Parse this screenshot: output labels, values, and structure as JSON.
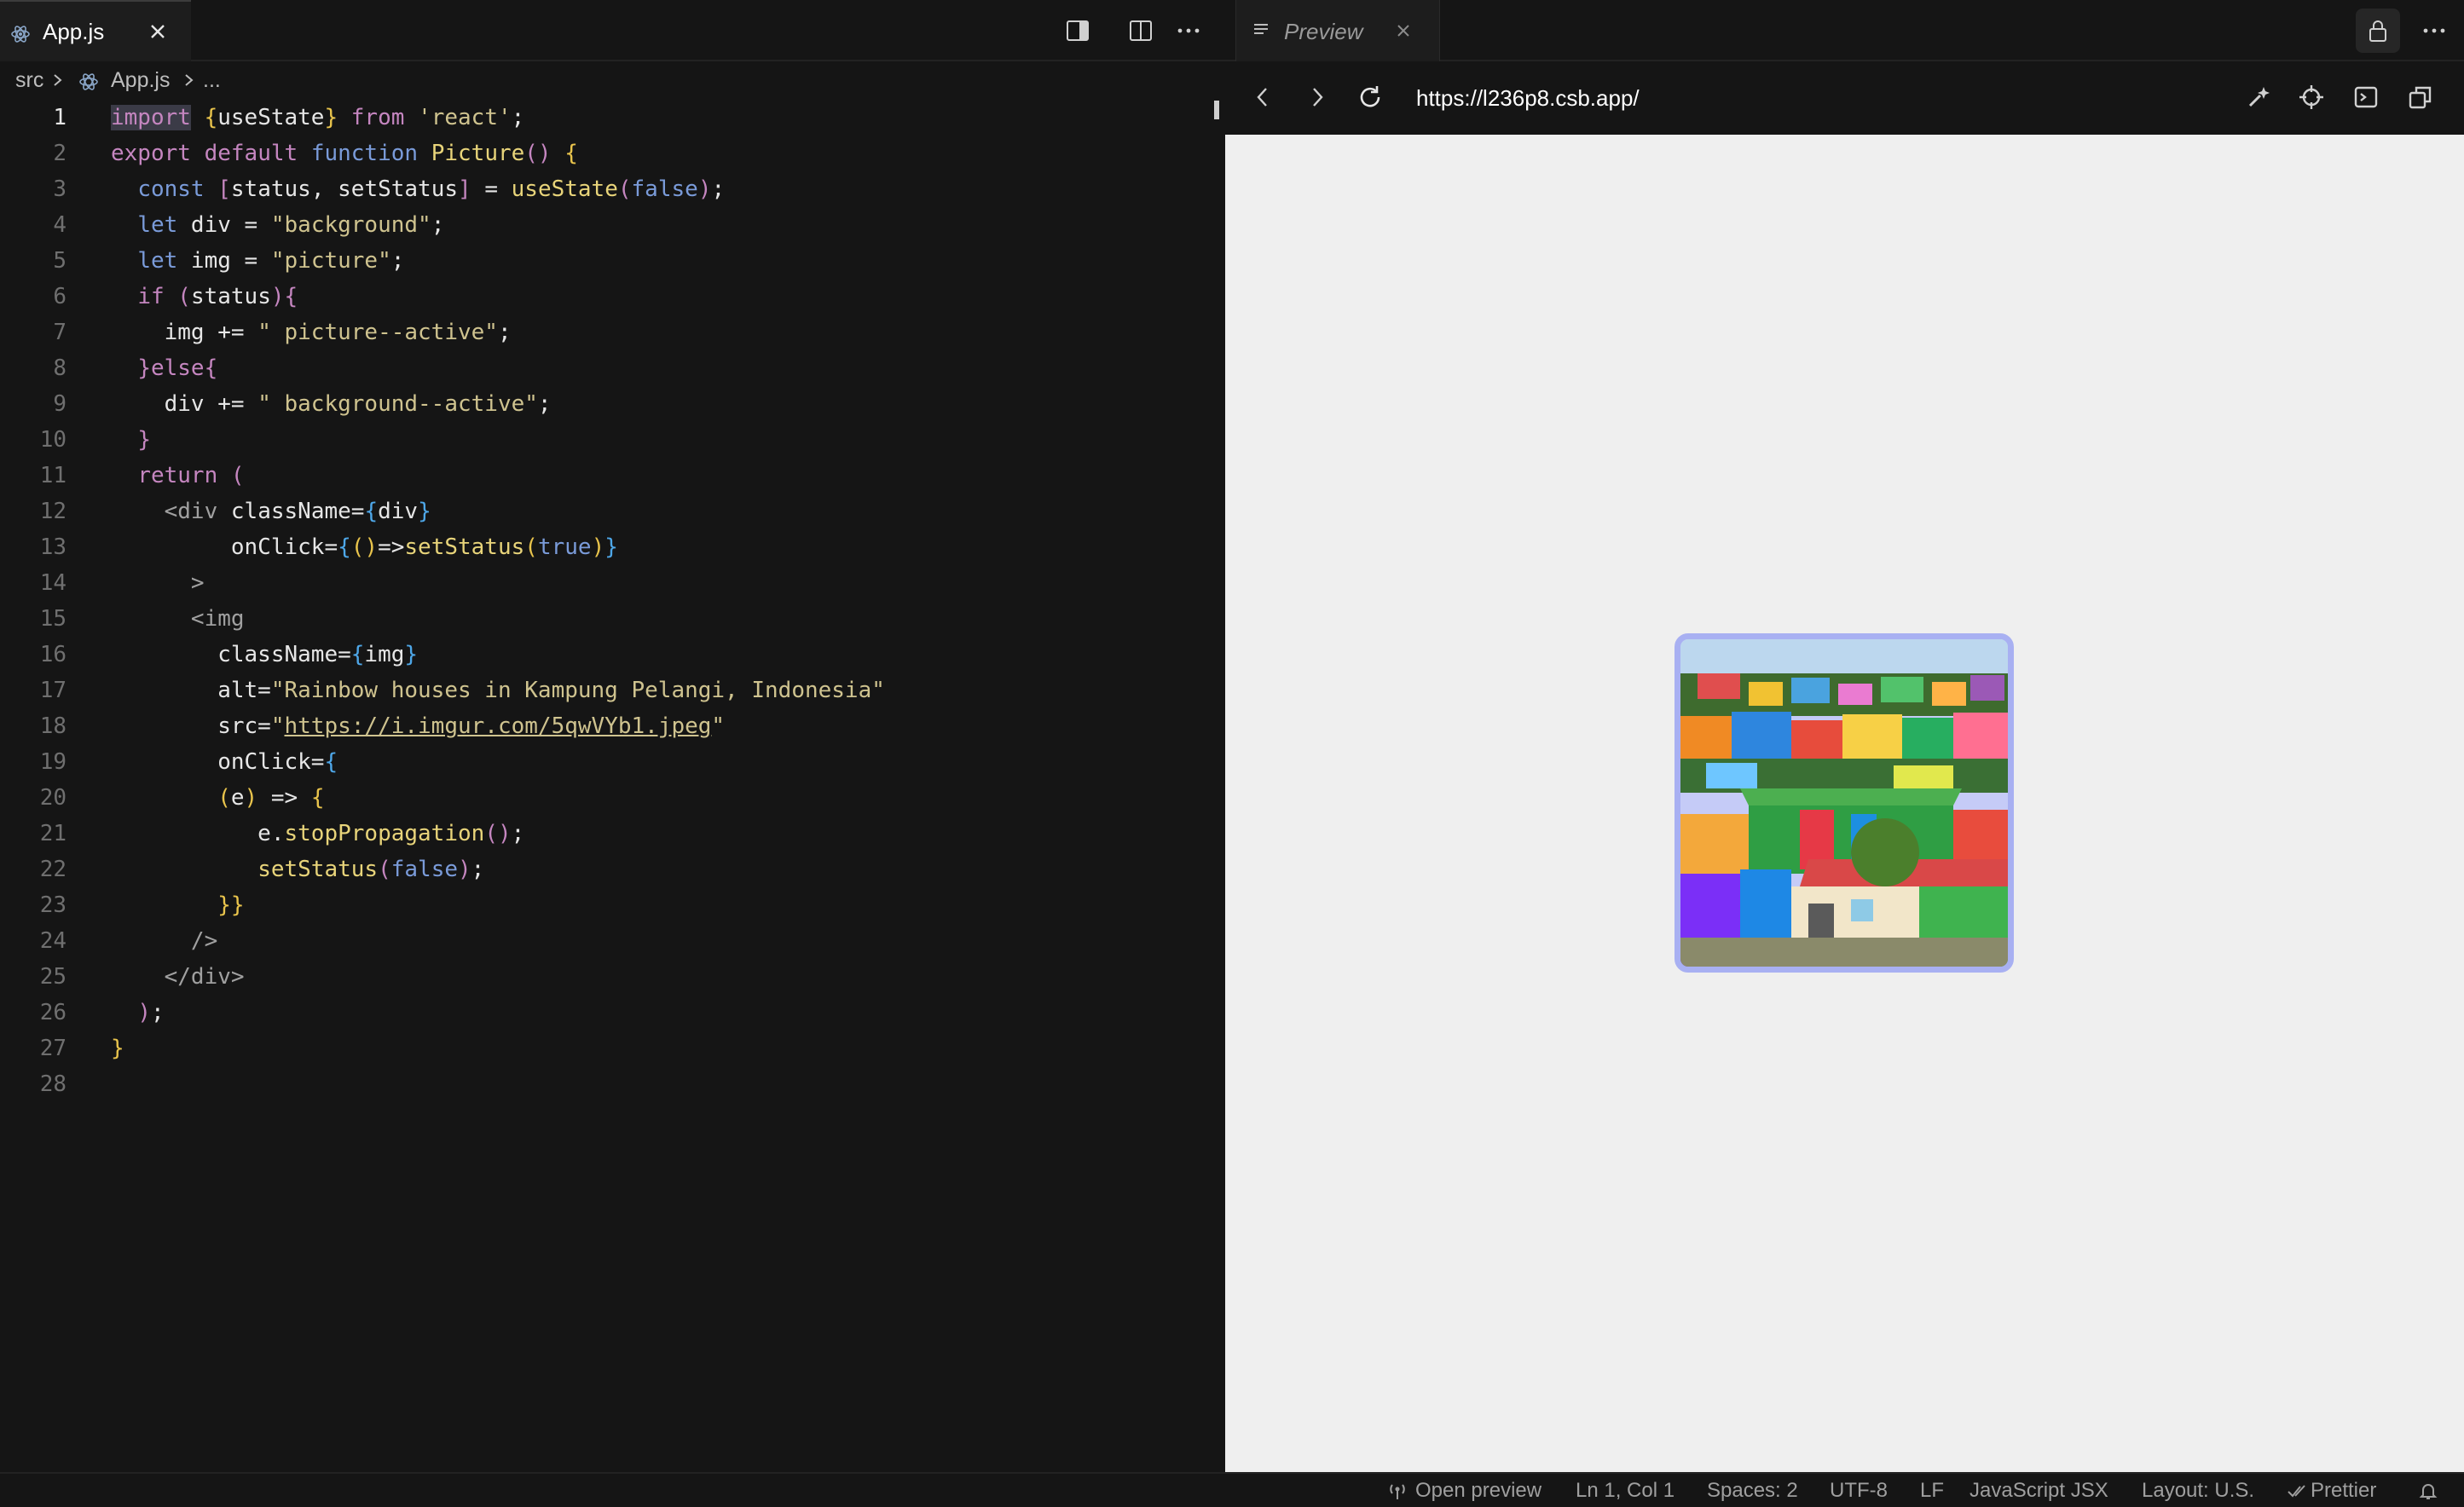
{
  "editor": {
    "tab": {
      "label": "App.js",
      "icon": "react-icon"
    },
    "breadcrumb": {
      "root": "src",
      "file": "App.js",
      "more": "..."
    },
    "line_numbers": [
      "1",
      "2",
      "3",
      "4",
      "5",
      "6",
      "7",
      "8",
      "9",
      "10",
      "11",
      "12",
      "13",
      "14",
      "15",
      "16",
      "17",
      "18",
      "19",
      "20",
      "21",
      "22",
      "23",
      "24",
      "25",
      "26",
      "27",
      "28"
    ],
    "code": {
      "l1": {
        "t1": "import",
        "t2": " ",
        "t3": "{",
        "t4": "useState",
        "t5": "}",
        "t6": " ",
        "t7": "from",
        "t8": " ",
        "t9": "'react'",
        "t10": ";"
      },
      "l2": {
        "t1": "export",
        "t2": " ",
        "t3": "default",
        "t4": " ",
        "t5": "function",
        "t6": " ",
        "t7": "Picture",
        "t8": "()",
        "t9": " ",
        "t10": "{"
      },
      "l3": {
        "t1": "  ",
        "t2": "const",
        "t3": " ",
        "t4": "[",
        "t5": "status, setStatus",
        "t6": "]",
        "t7": " = ",
        "t8": "useState",
        "t9": "(",
        "t10": "false",
        "t11": ")",
        "t12": ";"
      },
      "l4": {
        "t1": "  ",
        "t2": "let",
        "t3": " div = ",
        "t4": "\"background\"",
        "t5": ";"
      },
      "l5": {
        "t1": "  ",
        "t2": "let",
        "t3": " img = ",
        "t4": "\"picture\"",
        "t5": ";"
      },
      "l6": {
        "t1": "  ",
        "t2": "if",
        "t3": " ",
        "t4": "(",
        "t5": "status",
        "t6": ")",
        "t7": "{"
      },
      "l7": {
        "t1": "    img += ",
        "t2": "\" picture--active\"",
        "t3": ";"
      },
      "l8": {
        "t1": "  ",
        "t2": "}",
        "t3": "else",
        "t4": "{"
      },
      "l9": {
        "t1": "    div += ",
        "t2": "\" background--active\"",
        "t3": ";"
      },
      "l10": {
        "t1": "  ",
        "t2": "}"
      },
      "l11": {
        "t1": "  ",
        "t2": "return",
        "t3": " ",
        "t4": "("
      },
      "l12": {
        "t1": "    ",
        "t2": "<div",
        "t3": " className=",
        "t4": "{",
        "t5": "div",
        "t6": "}"
      },
      "l13": {
        "t1": "         onClick=",
        "t2": "{",
        "t3": "()",
        "t4": "=>",
        "t5": "setStatus",
        "t6": "(",
        "t7": "true",
        "t8": ")",
        "t9": "}"
      },
      "l14": {
        "t1": "      ",
        "t2": ">"
      },
      "l15": {
        "t1": "      ",
        "t2": "<img"
      },
      "l16": {
        "t1": "        className=",
        "t2": "{",
        "t3": "img",
        "t4": "}"
      },
      "l17": {
        "t1": "        alt=",
        "t2": "\"Rainbow houses in Kampung Pelangi, Indonesia\""
      },
      "l18": {
        "t1": "        src=",
        "t2": "\"",
        "t3": "https://i.imgur.com/5qwVYb1.jpeg",
        "t4": "\""
      },
      "l19": {
        "t1": "        onClick=",
        "t2": "{"
      },
      "l20": {
        "t1": "        ",
        "t2": "(",
        "t3": "e",
        "t4": ")",
        "t5": " => ",
        "t6": "{"
      },
      "l21": {
        "t1": "           e.",
        "t2": "stopPropagation",
        "t3": "()",
        "t4": ";"
      },
      "l22": {
        "t1": "           ",
        "t2": "setStatus",
        "t3": "(",
        "t4": "false",
        "t5": ")",
        "t6": ";"
      },
      "l23": {
        "t1": "        ",
        "t2": "}}"
      },
      "l24": {
        "t1": "      ",
        "t2": "/>"
      },
      "l25": {
        "t1": "    ",
        "t2": "</div>"
      },
      "l26": {
        "t1": "  ",
        "t2": ")",
        "t3": ";"
      },
      "l27": {
        "t1": "",
        "t2": "}"
      },
      "l28": {
        "t1": ""
      }
    }
  },
  "preview": {
    "tab": {
      "label": "Preview",
      "icon": "document-icon"
    },
    "url": "https://l236p8.csb.app/",
    "image_alt": "Rainbow houses in Kampung Pelangi, Indonesia"
  },
  "statusbar": {
    "open_preview": "Open preview",
    "position": "Ln 1, Col 1",
    "spaces": "Spaces: 2",
    "encoding": "UTF-8",
    "eol": "LF",
    "language": "JavaScript JSX",
    "layout": "Layout: U.S.",
    "prettier": "Prettier"
  },
  "colors": {
    "background": "#151515",
    "keyword": "#c586c0",
    "function": "#e8d47a",
    "string": "#cfc38f",
    "boolean": "#7a9bd9",
    "picture_border": "#a8b0f2",
    "preview_background": "#efefef"
  }
}
